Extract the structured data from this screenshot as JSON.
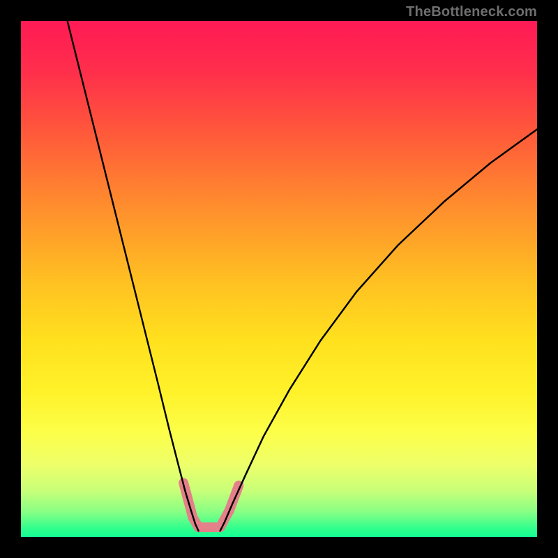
{
  "watermark": "TheBottleneck.com",
  "gradient_stops": [
    {
      "offset": 0.0,
      "color": "#ff1a55"
    },
    {
      "offset": 0.1,
      "color": "#ff2f4b"
    },
    {
      "offset": 0.22,
      "color": "#ff5a3a"
    },
    {
      "offset": 0.35,
      "color": "#ff8a2e"
    },
    {
      "offset": 0.5,
      "color": "#ffbf22"
    },
    {
      "offset": 0.62,
      "color": "#ffe11e"
    },
    {
      "offset": 0.72,
      "color": "#fff22a"
    },
    {
      "offset": 0.8,
      "color": "#fcff4a"
    },
    {
      "offset": 0.86,
      "color": "#edff6a"
    },
    {
      "offset": 0.91,
      "color": "#c8ff78"
    },
    {
      "offset": 0.95,
      "color": "#8aff84"
    },
    {
      "offset": 0.985,
      "color": "#2cff8e"
    },
    {
      "offset": 1.0,
      "color": "#14ff95"
    }
  ],
  "chart_data": {
    "type": "line",
    "title": "",
    "xlabel": "",
    "ylabel": "",
    "xlim": [
      0,
      100
    ],
    "ylim": [
      0,
      100
    ],
    "grid": false,
    "legend": false,
    "series": [
      {
        "name": "curve-left",
        "color": "#000000",
        "width": 2.5,
        "x": [
          9.0,
          12.0,
          15.0,
          18.0,
          21.0,
          24.0,
          26.5,
          28.7,
          30.5,
          31.8,
          33.0,
          33.8,
          34.4
        ],
        "y": [
          100.0,
          88.0,
          76.0,
          64.0,
          52.0,
          40.0,
          30.0,
          21.0,
          14.0,
          9.0,
          5.0,
          2.5,
          1.2
        ]
      },
      {
        "name": "curve-right",
        "color": "#000000",
        "width": 2.5,
        "x": [
          38.6,
          39.5,
          41.0,
          43.5,
          47.0,
          52.0,
          58.0,
          65.0,
          73.0,
          82.0,
          91.0,
          100.0
        ],
        "y": [
          1.2,
          3.0,
          6.5,
          12.0,
          19.5,
          28.5,
          38.0,
          47.5,
          56.5,
          65.0,
          72.5,
          79.0
        ]
      },
      {
        "name": "bottom-flat",
        "color": "#14ff95",
        "width": 0,
        "x": [
          34.4,
          35.5,
          36.5,
          37.5,
          38.6
        ],
        "y": [
          1.0,
          0.9,
          0.9,
          0.9,
          1.0
        ]
      }
    ],
    "highlight": {
      "name": "bottom-marker",
      "color": "#e4808a",
      "stroke_width": 14,
      "segments": [
        {
          "x1": 31.5,
          "y1": 10.5,
          "x2": 33.3,
          "y2": 3.8
        },
        {
          "x1": 33.3,
          "y1": 3.8,
          "x2": 34.4,
          "y2": 1.9
        },
        {
          "x1": 34.4,
          "y1": 1.9,
          "x2": 38.6,
          "y2": 1.9
        },
        {
          "x1": 38.6,
          "y1": 1.9,
          "x2": 40.4,
          "y2": 5.2
        },
        {
          "x1": 40.4,
          "y1": 5.2,
          "x2": 42.2,
          "y2": 10.0
        }
      ]
    }
  }
}
